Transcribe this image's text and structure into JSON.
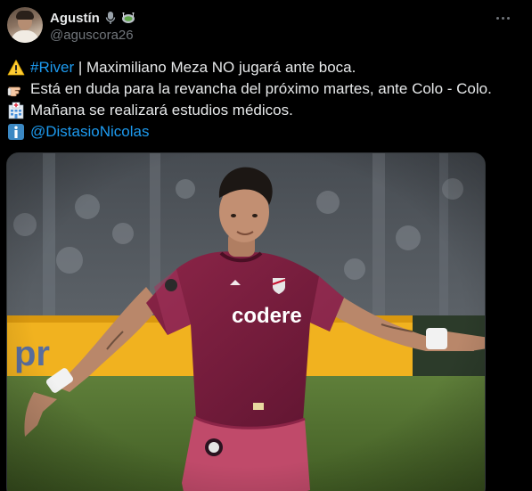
{
  "author": {
    "display_name": "Agustín",
    "handle": "@aguscora26",
    "badges": [
      "microphone-icon",
      "stadium-icon"
    ],
    "avatar": "avatar"
  },
  "menu_icon": "more-options-icon",
  "tweet": {
    "lines": [
      {
        "icon": "warning-icon",
        "hashtag": "#River",
        "text": " | Maximiliano Meza NO jugará ante boca."
      },
      {
        "icon": "pointing-hand-icon",
        "text": "Está en duda para la revancha del próximo martes, ante Colo - Colo."
      },
      {
        "icon": "hospital-icon",
        "text": "Mañana se realizará estudios médicos."
      },
      {
        "icon": "information-icon",
        "mention": "@DistasioNicolas"
      }
    ]
  },
  "media": {
    "shirt_sponsor": "codere",
    "description_icon": "photo"
  },
  "colors": {
    "background": "#000000",
    "text": "#e7e9ea",
    "secondary": "#71767b",
    "link": "#1d9bf0",
    "jersey": "#7a1d3e"
  }
}
